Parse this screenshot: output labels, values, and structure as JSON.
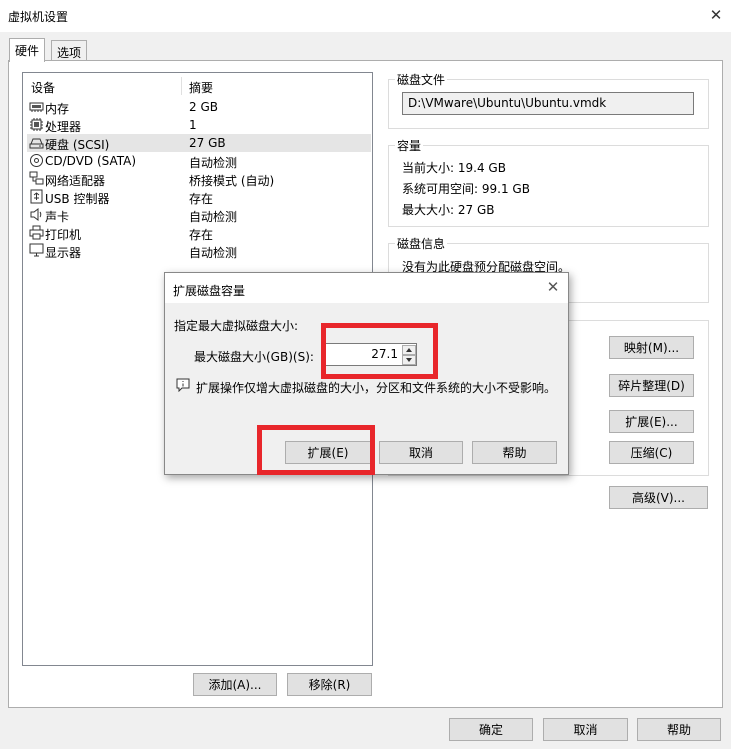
{
  "window": {
    "title": "虚拟机设置",
    "close_glyph": "✕"
  },
  "tabs": [
    {
      "label": "硬件"
    },
    {
      "label": "选项"
    }
  ],
  "device_list": {
    "headers": {
      "device": "设备",
      "summary": "摘要"
    },
    "rows": [
      {
        "name": "内存",
        "value": "2 GB",
        "icon": "memory-icon"
      },
      {
        "name": "处理器",
        "value": "1",
        "icon": "processor-icon"
      },
      {
        "name": "硬盘 (SCSI)",
        "value": "27 GB",
        "icon": "hard-disk-icon",
        "selected": true
      },
      {
        "name": "CD/DVD (SATA)",
        "value": "自动检测",
        "icon": "cd-dvd-icon"
      },
      {
        "name": "网络适配器",
        "value": "桥接模式 (自动)",
        "icon": "network-adapter-icon"
      },
      {
        "name": "USB 控制器",
        "value": "存在",
        "icon": "usb-controller-icon"
      },
      {
        "name": "声卡",
        "value": "自动检测",
        "icon": "sound-card-icon"
      },
      {
        "name": "打印机",
        "value": "存在",
        "icon": "printer-icon"
      },
      {
        "name": "显示器",
        "value": "自动检测",
        "icon": "display-icon"
      }
    ],
    "add_button": "添加(A)...",
    "remove_button": "移除(R)"
  },
  "disk_file": {
    "title": "磁盘文件",
    "path": "D:\\VMware\\Ubuntu\\Ubuntu.vmdk"
  },
  "capacity": {
    "title": "容量",
    "current_size": "当前大小: 19.4 GB",
    "system_free": "系统可用空间: 99.1 GB",
    "max_size": "最大大小: 27 GB"
  },
  "disk_info": {
    "title": "磁盘信息",
    "text": "没有为此硬盘预分配磁盘空间。"
  },
  "utilities": {
    "map_button": "映射(M)...",
    "defrag_button": "碎片整理(D)",
    "expand_button": "扩展(E)...",
    "compact_button": "压缩(C)"
  },
  "advanced_button": "高级(V)...",
  "footer": {
    "ok": "确定",
    "cancel": "取消",
    "help": "帮助"
  },
  "expand_dialog": {
    "title": "扩展磁盘容量",
    "close_glyph": "✕",
    "prompt": "指定最大虚拟磁盘大小:",
    "field_label": "最大磁盘大小(GB)(S):",
    "field_value": "27.1",
    "info_text": "扩展操作仅增大虚拟磁盘的大小，分区和文件系统的大小不受影响。",
    "expand_button": "扩展(E)",
    "cancel_button": "取消",
    "help_button": "帮助"
  },
  "colors": {
    "highlight_red": "#e8262b",
    "selection": "#e5e5e5"
  }
}
